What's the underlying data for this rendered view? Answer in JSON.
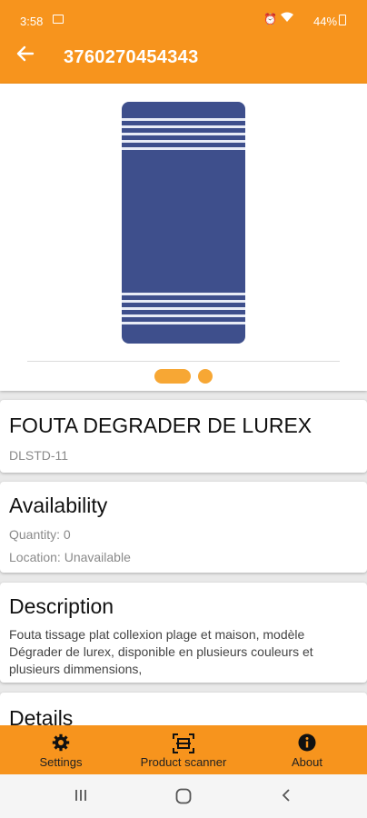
{
  "status_bar": {
    "time": "3:58",
    "battery": "44%"
  },
  "app_bar": {
    "title": "3760270454343"
  },
  "product": {
    "name": "FOUTA DEGRADER DE LUREX",
    "sku": "DLSTD-11"
  },
  "availability": {
    "heading": "Availability",
    "quantity": "Quantity: 0",
    "location": "Location: Unavailable"
  },
  "description": {
    "heading": "Description",
    "text": "Fouta tissage plat collexion plage et maison, modèle Dégrader de lurex, disponible en plusieurs couleurs et plusieurs dimmensions,"
  },
  "details": {
    "heading": "Details"
  },
  "bottom_nav": {
    "settings": "Settings",
    "scanner": "Product scanner",
    "about": "About"
  },
  "colors": {
    "accent": "#f7941d",
    "towel": "#3e4f8c"
  }
}
